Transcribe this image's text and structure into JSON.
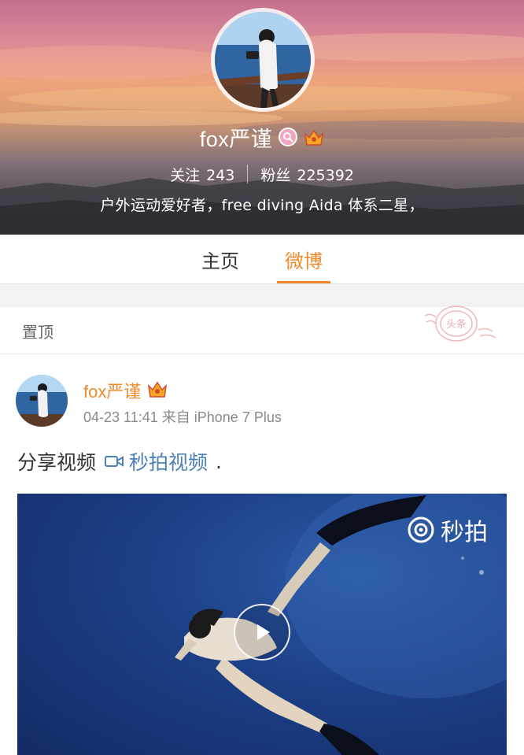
{
  "profile": {
    "username": "fox严谨",
    "following_label": "关注",
    "following_count": "243",
    "followers_label": "粉丝",
    "followers_count": "225392",
    "bio": "户外运动爱好者，free diving Aida 体系二星，"
  },
  "tabs": [
    {
      "label": "主页",
      "active": false
    },
    {
      "label": "微博",
      "active": true
    }
  ],
  "pinned": {
    "label": "置顶",
    "stamp_text": "头条"
  },
  "post": {
    "author": "fox严谨",
    "timestamp": "04-23 11:41",
    "source": "来自 iPhone 7 Plus",
    "text": "分享视频",
    "link_text": "秒拍视频",
    "trailing": ".",
    "video": {
      "provider_label": "秒拍",
      "play_icon": "play-icon"
    }
  },
  "colors": {
    "accent": "#f08a2c",
    "link": "#4c7fb7",
    "vip_badge": "#f3a4bf"
  }
}
